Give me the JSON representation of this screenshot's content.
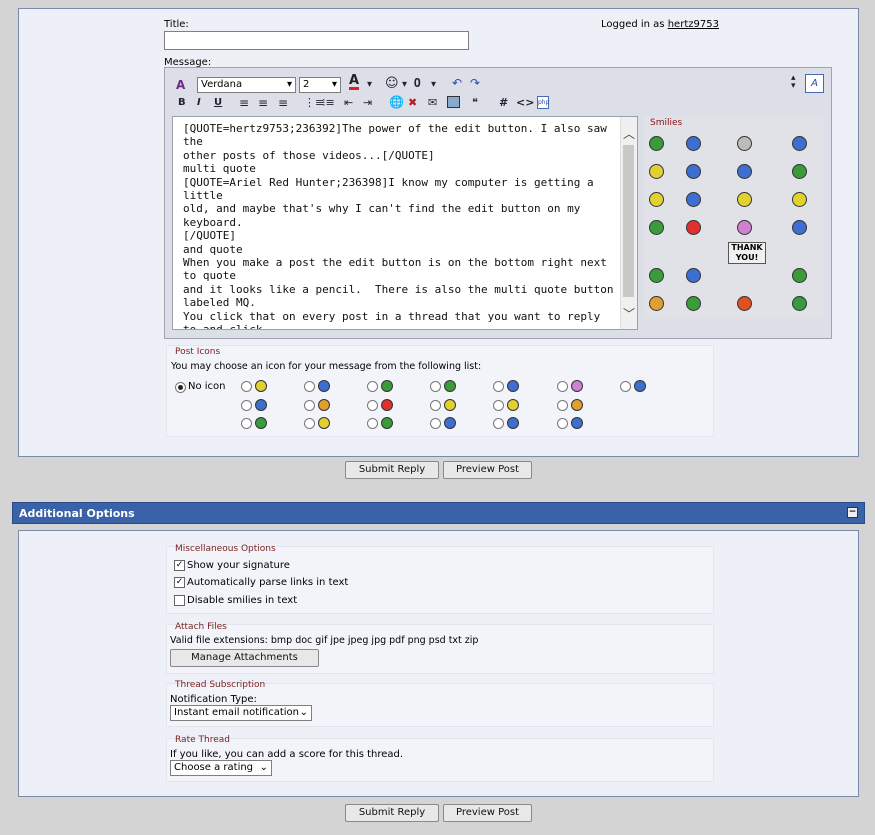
{
  "post_form": {
    "title_label": "Title:",
    "title_value": "",
    "logged_in_text": "Logged in as",
    "username": "hertz9753",
    "message_label": "Message:"
  },
  "toolbar": {
    "font_name": "Verdana",
    "font_size": "2",
    "buttons_row2": [
      "B",
      "I",
      "U"
    ],
    "hash": "#",
    "code": "<>"
  },
  "message_text": "[QUOTE=hertz9753;236392]The power of the edit button. I also saw the\nother posts of those videos...[/QUOTE]\nmulti quote\n[QUOTE=Ariel Red Hunter;236398]I know my computer is getting a little\nold, and maybe that's why I can't find the edit button on my keyboard.\n[/QUOTE]\nand quote\nWhen you make a post the edit button is on the bottom right next to quote\nand it looks like a pencil.  There is also the multi quote button labeled MQ.\nYou click that on every post in a thread that you want to reply to and click\non quote on the final one.\n\nIt looks like this.",
  "smilies": {
    "title": "Smilies",
    "thank_you": "THANK\nYOU!",
    "icons": [
      {
        "color": "#3a9b3a"
      },
      {
        "color": "#3d6fd0"
      },
      {
        "color": "#bbbbbb"
      },
      {
        "color": "#3d6fd0"
      },
      {
        "color": "#e0d030"
      },
      {
        "color": "#3d6fd0"
      },
      {
        "color": "#3d6fd0"
      },
      {
        "color": "#3a9b3a"
      },
      {
        "color": "#e0d030"
      },
      {
        "color": "#3d6fd0"
      },
      {
        "color": "#e0d030"
      },
      {
        "color": "#e0d030"
      },
      {
        "color": "#3a9b3a"
      },
      {
        "color": "#e03030"
      },
      {
        "color": "#d080d0"
      },
      {
        "color": "#3d6fd0"
      },
      {
        "color": "#3a9b3a"
      },
      {
        "color": "#3d6fd0"
      },
      {
        "color": "#e0d030"
      },
      {
        "color": "#3a9b3a"
      },
      {
        "color": "#e0a030"
      },
      {
        "color": "#3a9b3a"
      },
      {
        "color": "#e05020"
      },
      {
        "color": "#3a9b3a"
      }
    ]
  },
  "post_icons": {
    "title": "Post Icons",
    "instruction": "You may choose an icon for your message from the following list:",
    "no_icon": "No icon",
    "row1": [
      "#e0d030",
      "#3d6fd0",
      "#3a9b3a",
      "#3a9b3a",
      "#3d6fd0",
      "#d080d0",
      "#3d6fd0"
    ],
    "row2": [
      "#3d6fd0",
      "#e0a030",
      "#e03030",
      "#e0d030",
      "#e0d030",
      "#e0a030",
      "#3d6fd0"
    ],
    "row3": [
      "#3a9b3a",
      "#e0d030",
      "#3a9b3a",
      "#3d6fd0",
      "#3d6fd0",
      "#3d6fd0",
      "#3a9b3a"
    ]
  },
  "buttons": {
    "submit": "Submit Reply",
    "preview": "Preview Post"
  },
  "additional": {
    "header": "Additional Options",
    "collapse": "−",
    "misc_title": "Miscellaneous Options",
    "show_signature": "Show your signature",
    "parse_links": "Automatically parse links in text",
    "disable_smilies": "Disable smilies in text",
    "attach_title": "Attach Files",
    "extensions": "Valid file extensions: bmp doc gif jpe jpeg jpg pdf png psd txt zip",
    "manage_attachments": "Manage Attachments",
    "subscription_title": "Thread Subscription",
    "notification_label": "Notification Type:",
    "notification_value": "Instant email notification",
    "rate_title": "Rate Thread",
    "rate_text": "If you like, you can add a score for this thread.",
    "rate_value": "Choose a rating"
  },
  "colors": {
    "header_bg": "#3a62a8",
    "panel_bg": "#eef0f8",
    "section_red": "#7a1f1f"
  }
}
